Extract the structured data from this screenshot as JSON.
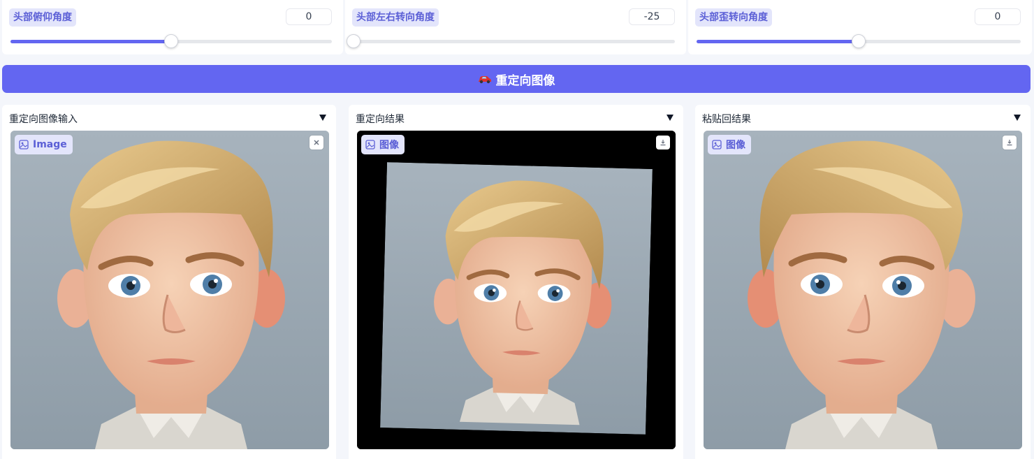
{
  "sliders": [
    {
      "label": "头部俯仰角度",
      "value": "0",
      "fraction": 0.5
    },
    {
      "label": "头部左右转向角度",
      "value": "-25",
      "fraction": 0.0
    },
    {
      "label": "头部歪转向角度",
      "value": "0",
      "fraction": 0.5
    }
  ],
  "run_button": {
    "icon": "car-icon",
    "label": "重定向图像"
  },
  "panels": [
    {
      "title": "重定向图像输入",
      "badge": "Image",
      "corner_icon": "close-icon"
    },
    {
      "title": "重定向结果",
      "badge": "图像",
      "corner_icon": "download-icon"
    },
    {
      "title": "粘贴回结果",
      "badge": "图像",
      "corner_icon": "download-icon"
    }
  ],
  "colors": {
    "accent": "#6366f1",
    "badge_bg": "#e3e5fb",
    "badge_text": "#5b5fd6",
    "page_bg": "#f4f6fb"
  }
}
